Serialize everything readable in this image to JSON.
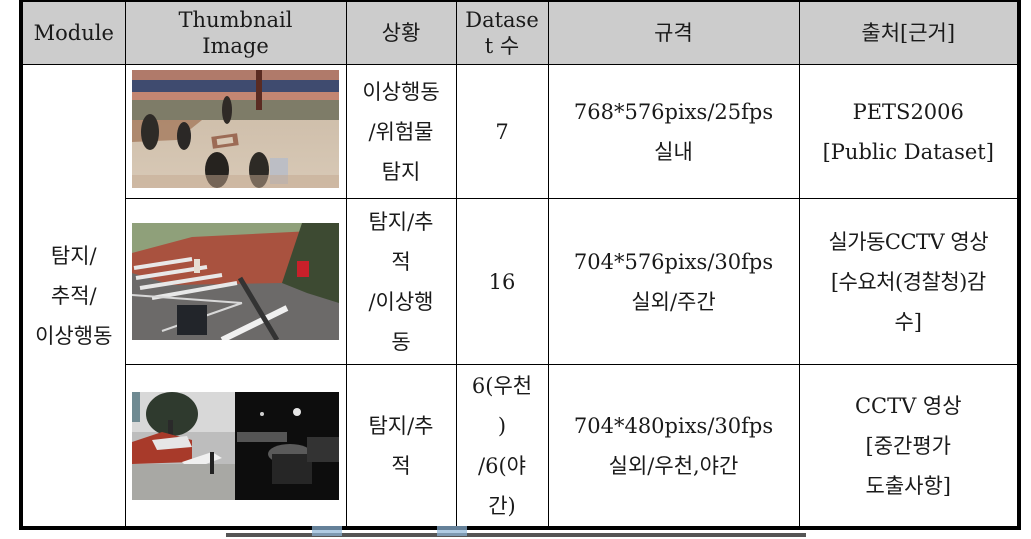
{
  "table": {
    "headers": {
      "module": "Module",
      "thumbnail": [
        "Thumbnail",
        "Image"
      ],
      "situation": "상황",
      "dataset_count": [
        "Datase",
        "t 수"
      ],
      "spec": "규격",
      "source": "출처[근거]"
    },
    "module_label": [
      "탐지/",
      "추적/",
      "이상행동"
    ],
    "rows": [
      {
        "thumbnail_icon": "indoor-lobby-pedestrians-image",
        "situation": [
          "이상행동",
          "/위험물",
          "탐지"
        ],
        "dataset_count": [
          "7"
        ],
        "spec": [
          "768*576pixs/25fps",
          "실내"
        ],
        "source": [
          "PETS2006",
          "[Public Dataset]"
        ]
      },
      {
        "thumbnail_icon": "outdoor-crosswalk-daytime-image",
        "situation": [
          "탐지/추",
          "적",
          "/이상행",
          "동"
        ],
        "dataset_count": [
          "16"
        ],
        "spec": [
          "704*576pixs/30fps",
          "실외/주간"
        ],
        "source": [
          "실가동CCTV 영상",
          "[수요처(경찰청)감",
          "수]"
        ]
      },
      {
        "thumbnail_icon": "outdoor-rain-night-split-image",
        "situation": [
          "탐지/추",
          "적"
        ],
        "dataset_count": [
          "6(우천",
          ")",
          "/6(야",
          "간)"
        ],
        "spec": [
          "704*480pixs/30fps",
          "실외/우천,야간"
        ],
        "source": [
          "CCTV 영상",
          "[중간평가",
          "도출사항]"
        ]
      }
    ]
  },
  "colors": {
    "header_bg": "#cccccc",
    "border": "#000000"
  }
}
